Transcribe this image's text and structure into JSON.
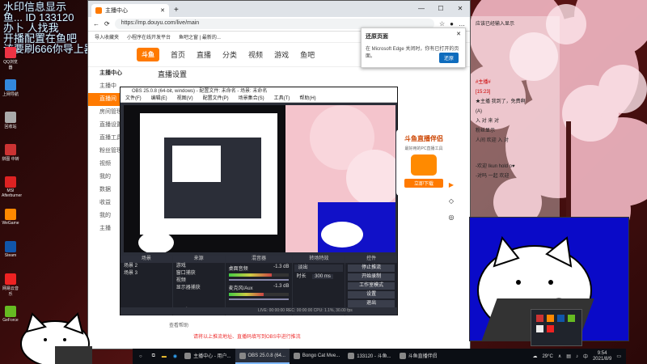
{
  "overlay_lines": [
    "水印信息显示",
    "鱼... ID 133120",
    "办卜 人找我",
    "开播配置在鱼吧",
    "该要刷666你导上器"
  ],
  "desktop_icons": [
    {
      "label": "QQ浏览器",
      "color": "#e34"
    },
    {
      "label": "上网导航",
      "color": "#38d"
    },
    {
      "label": "回收站",
      "color": "#aaa"
    },
    {
      "label": "拼图 中转",
      "color": "#c33"
    },
    {
      "label": "MSI Afterburner",
      "color": "#d22"
    },
    {
      "label": "WeGame",
      "color": "#f80"
    },
    {
      "label": "Steam",
      "color": "#15a"
    },
    {
      "label": "网易云音乐",
      "color": "#e22"
    },
    {
      "label": "GeForce",
      "color": "#6b2"
    }
  ],
  "browser": {
    "tab_title": "主播中心",
    "url": "https://mp.douyu.com/live/main",
    "bookmarks": [
      "导入收藏夹",
      "小程序在线开发平台",
      "鱼吧之窗 | 最新的..."
    ],
    "logo": "斗鱼",
    "nav": [
      "首页",
      "直播",
      "分类",
      "视频",
      "游戏",
      "鱼吧"
    ],
    "page_title": "直播设置",
    "sidebar_header": "主播中心",
    "sidebar": [
      "主播中",
      "直播间",
      "房间管理",
      "直播设置",
      "直播工具",
      "粉丝管理",
      "视频",
      "我的",
      "数据",
      "收益",
      "我的",
      "主播"
    ],
    "footer_note": "请将以上推流地址、直播码填写到OBS中进行推流",
    "footer_link": "查看帮助"
  },
  "notification": {
    "title": "还原页面",
    "body": "在 Microsoft Edge 关闭时，你有已打开的页面。",
    "button": "还原"
  },
  "obs": {
    "title": "OBS 25.0.8 (64-bit, windows) - 配置文件: 未命名 - 场景: 未命名",
    "menu": [
      "文件(F)",
      "编辑(E)",
      "视图(V)",
      "配置文件(P)",
      "场景集合(S)",
      "工具(T)",
      "帮助(H)"
    ],
    "docks": {
      "scenes_title": "场景",
      "scenes": [
        "场景 2",
        "场景 3"
      ],
      "sources_title": "来源",
      "sources": [
        "游戏",
        "窗口捕获",
        "视频",
        "显示器捕获"
      ],
      "mixer_title": "混音器",
      "mixer": [
        {
          "name": "桌面音频",
          "db": "-1.3 dB",
          "level": 0.72
        },
        {
          "name": "麦克风/Aux",
          "db": "-1.3 dB",
          "level": 0.58
        }
      ],
      "transition_title": "转场特效",
      "transition": {
        "type": "淡出",
        "duration_label": "时长",
        "duration": "300 ms"
      },
      "controls_title": "控件",
      "controls": [
        "停止推流",
        "开始录制",
        "工作室模式",
        "设置",
        "退出"
      ]
    },
    "status": "LIVE: 00:00:00   REC: 00:00:00   CPU: 1.1%, 30.00 fps"
  },
  "promo": {
    "title": "斗鱼直播伴侣",
    "text": "最好用的PC直播工具",
    "button": "立即下载"
  },
  "chat": [
    "应该已经输入显示",
    "#主播#",
    "[15:23]",
    "★主播 我到了，免费啊",
    "(A)",
    "入 对 来 对",
    "粉丝显示",
    "人间 欢迎 入 对",
    "-欢迎 Ikun hold o♥",
    "-对吗 一起 欢迎"
  ],
  "taskbar": {
    "items": [
      {
        "label": "",
        "active": false
      },
      {
        "label": "主播中心 - 用户...",
        "active": false
      },
      {
        "label": "OBS 25.0.8 (64...",
        "active": true
      },
      {
        "label": "Bongo Cat Mve...",
        "active": false
      },
      {
        "label": "133120 - 斗鱼...",
        "active": false
      },
      {
        "label": "斗鱼直播伴侣",
        "active": false
      }
    ],
    "weather": "29°C",
    "ime": "中",
    "time": "9:54",
    "date": "2021/8/9"
  },
  "colors": {
    "accent": "#ff7a00",
    "bongo_bg": "#0a0ac8",
    "obs_bg": "#2b2e38",
    "blossom": "#f7c6cf"
  }
}
